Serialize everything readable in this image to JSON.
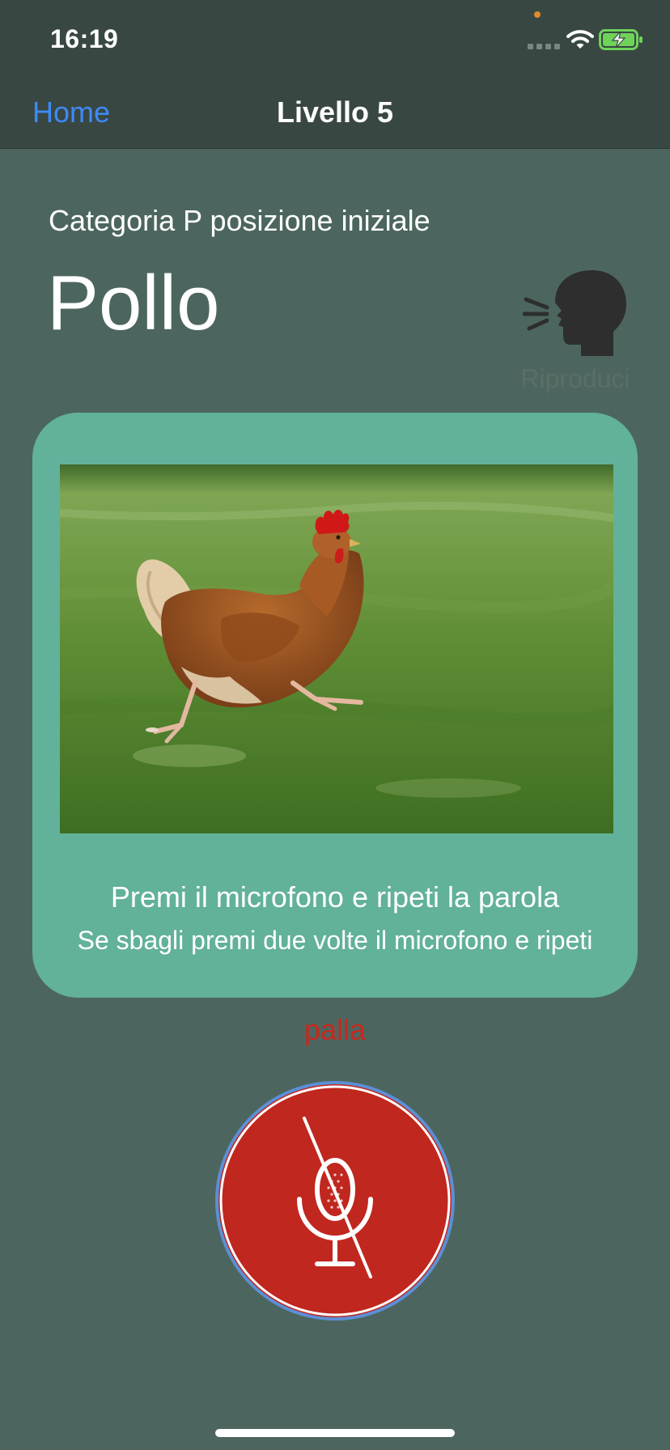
{
  "status_bar": {
    "time": "16:19"
  },
  "nav": {
    "back_label": "Home",
    "title": "Livello 5"
  },
  "category": "Categoria P posizione iniziale",
  "word": "Pollo",
  "speak": {
    "label": "Riproduci",
    "icon": "speaking-head-icon"
  },
  "card": {
    "image": "chicken-walking-on-grass",
    "instruction_primary": "Premi il microfono e ripeti la parola",
    "instruction_secondary": "Se sbagli premi due volte il microfono e ripeti"
  },
  "recognized_text": "palla",
  "mic": {
    "icon": "microphone-off-icon",
    "state": "muted"
  },
  "colors": {
    "background": "#4c665f",
    "header": "#394743",
    "accent_link": "#3d8af7",
    "card": "#62b19a",
    "mic_button": "#c0271e",
    "mic_ring": "#5b8fd6",
    "recognized_text": "#c9271e"
  }
}
